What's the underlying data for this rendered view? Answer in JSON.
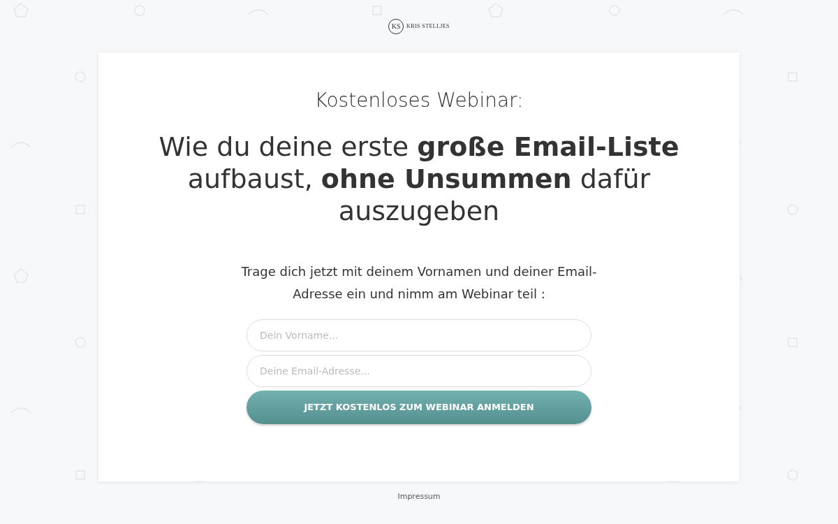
{
  "logo": {
    "mark": "KS",
    "name": "KRIS STELLJES"
  },
  "card": {
    "kicker": "Kostenloses Webinar:",
    "headline": "Wie du deine erste **große Email-Liste** aufbaust, **ohne Unsummen** dafür auszugeben",
    "intro": "Trage dich jetzt mit deinem Vornamen und deiner Email-Adresse ein und nimm am Webinar teil :",
    "fields": [
      {
        "placeholder": "Dein Vorname..."
      },
      {
        "placeholder": "Deine Email-Adresse..."
      }
    ],
    "button": "JETZT KOSTENLOS ZUM WEBINAR ANMELDEN"
  },
  "footer": {
    "link": "Impressum"
  }
}
